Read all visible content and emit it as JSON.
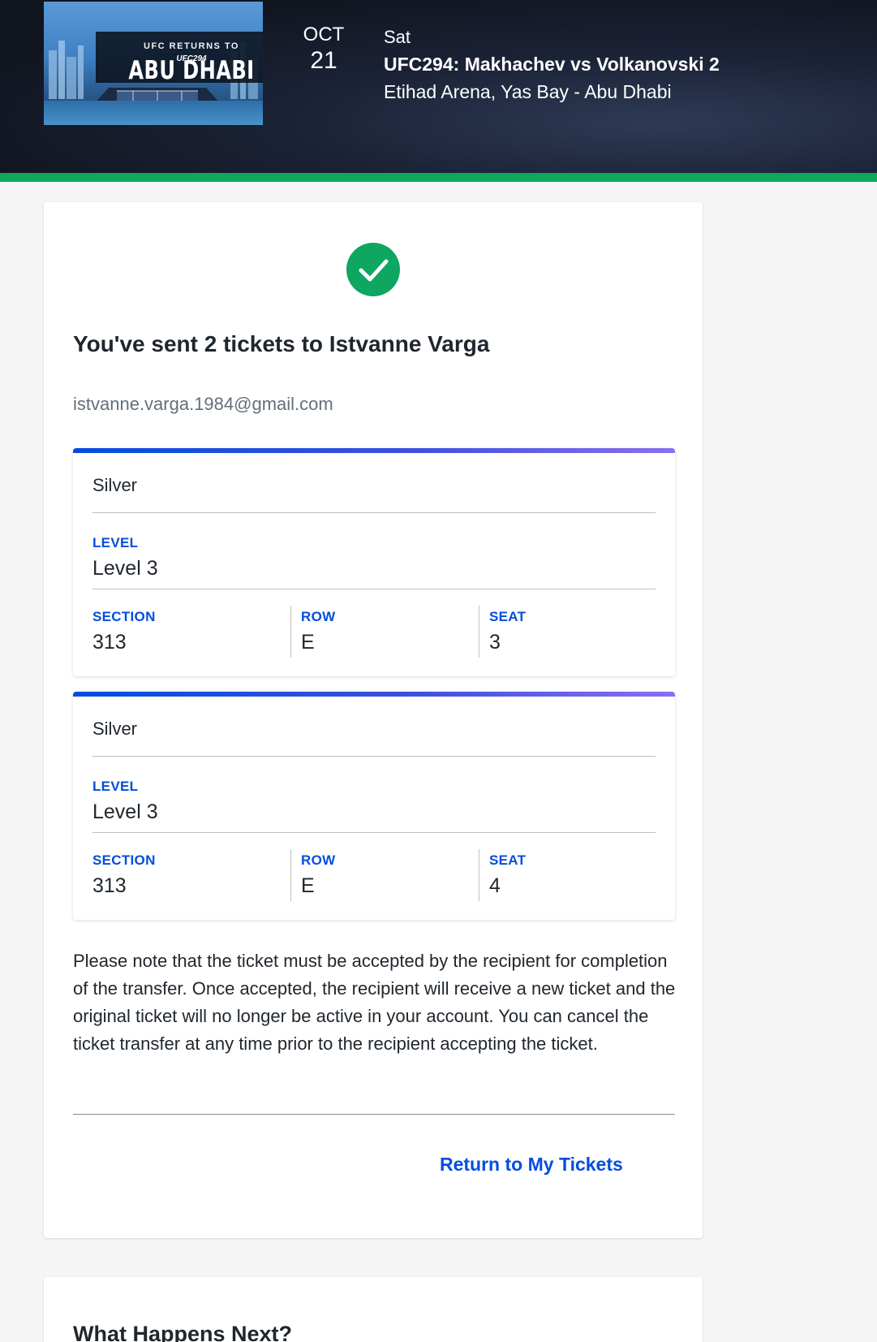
{
  "event": {
    "image_text": {
      "line1": "UFC RETURNS TO",
      "line2": "ABU DHABI",
      "line3": "UFC294"
    },
    "month": "OCT",
    "day": "21",
    "weekday": "Sat",
    "name": "UFC294: Makhachev vs Volkanovski 2",
    "venue": "Etihad Arena, Yas Bay - Abu Dhabi"
  },
  "colors": {
    "accent_green": "#0da85b",
    "link_blue": "#024ddf"
  },
  "confirmation": {
    "icon": "check-circle-icon",
    "title": "You've sent 2 tickets to Istvanne Varga",
    "email": "istvanne.varga.1984@gmail.com"
  },
  "tickets": [
    {
      "type": "Silver",
      "level_label": "LEVEL",
      "level": "Level 3",
      "section_label": "SECTION",
      "section": "313",
      "row_label": "ROW",
      "row": "E",
      "seat_label": "SEAT",
      "seat": "3"
    },
    {
      "type": "Silver",
      "level_label": "LEVEL",
      "level": "Level 3",
      "section_label": "SECTION",
      "section": "313",
      "row_label": "ROW",
      "row": "E",
      "seat_label": "SEAT",
      "seat": "4"
    }
  ],
  "note": "Please note that the ticket must be accepted by the recipient for completion of the transfer. Once accepted, the recipient will receive a new ticket and the original ticket will no longer be active in your account. You can cancel the ticket transfer at any time prior to the recipient accepting the ticket.",
  "return_link": "Return to My Tickets",
  "next_section": {
    "heading": "What Happens Next?"
  }
}
